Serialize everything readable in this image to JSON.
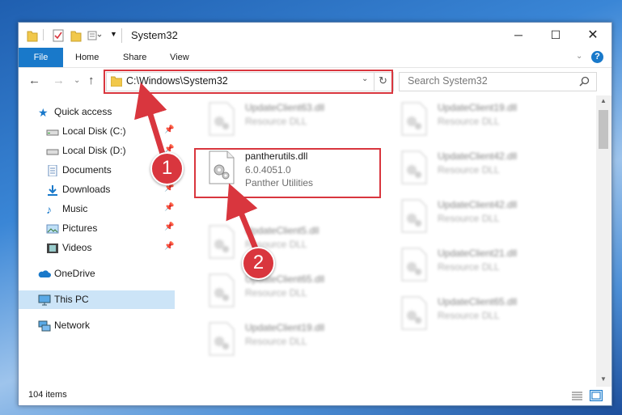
{
  "window": {
    "title": "System32"
  },
  "ribbon": {
    "tabs": [
      "File",
      "Home",
      "Share",
      "View"
    ]
  },
  "nav": {
    "address": "C:\\Windows\\System32",
    "search_placeholder": "Search System32"
  },
  "sidebar": {
    "items": [
      "Quick access",
      "Local Disk (C:)",
      "Local Disk (D:)",
      "Documents",
      "Downloads",
      "Music",
      "Pictures",
      "Videos",
      "OneDrive",
      "This PC",
      "Network"
    ]
  },
  "files": {
    "highlighted": {
      "name": "pantherutils.dll",
      "version": "6.0.4051.0",
      "description": "Panther Utilities"
    },
    "left": [
      {
        "name": "UpdateClient63.dll",
        "desc": "Resource DLL"
      },
      {
        "name": "UpdateClient5.dll",
        "desc": "Resource DLL"
      },
      {
        "name": "UpdateClient65.dll",
        "desc": "Resource DLL"
      },
      {
        "name": "UpdateClient19.dll",
        "desc": "Resource DLL"
      }
    ],
    "right": [
      {
        "name": "UpdateClient19.dll",
        "desc": "Resource DLL"
      },
      {
        "name": "UpdateClient42.dll",
        "desc": "Resource DLL"
      },
      {
        "name": "UpdateClient42.dll",
        "desc": "Resource DLL"
      },
      {
        "name": "UpdateClient21.dll",
        "desc": "Resource DLL"
      },
      {
        "name": "UpdateClient65.dll",
        "desc": "Resource DLL"
      }
    ]
  },
  "status": {
    "items": "104 items"
  },
  "badges": {
    "one": "1",
    "two": "2"
  },
  "colors": {
    "highlight": "#d9363e",
    "accent": "#1979ca",
    "selected": "#cce4f7"
  }
}
